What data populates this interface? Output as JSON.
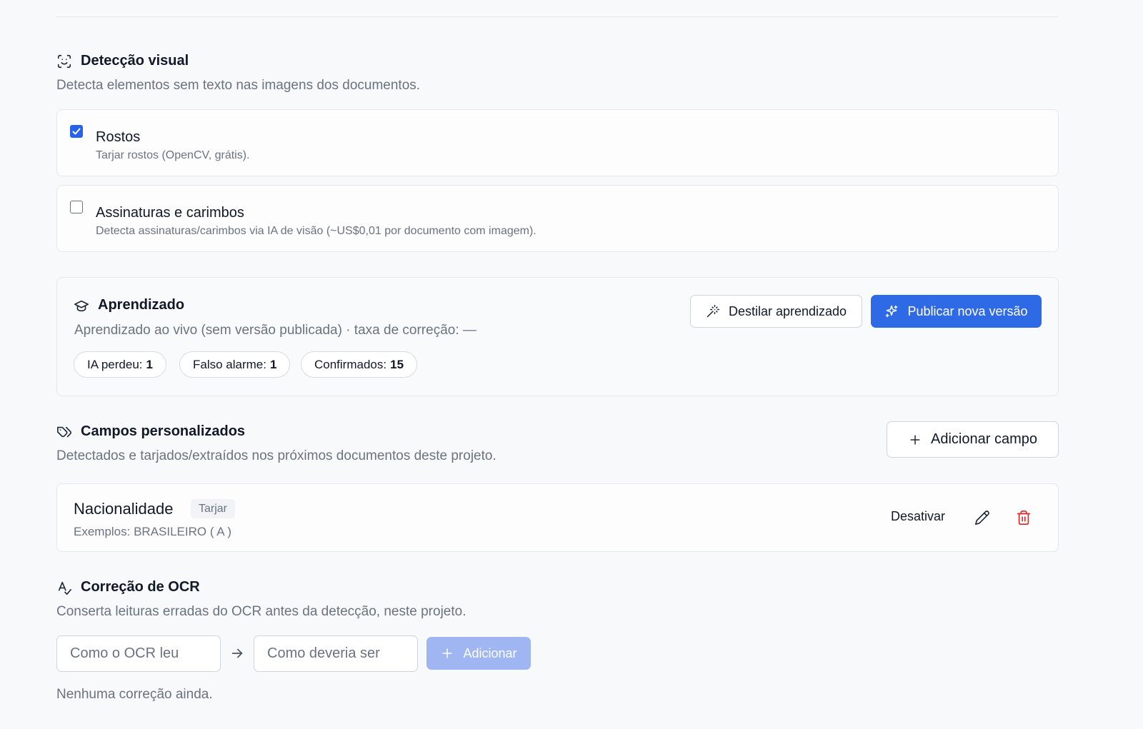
{
  "visual_detection": {
    "title": "Detecção visual",
    "description": "Detecta elementos sem texto nas imagens dos documentos.",
    "options": [
      {
        "title": "Rostos",
        "subtitle": "Tarjar rostos (OpenCV, grátis).",
        "checked": true
      },
      {
        "title": "Assinaturas e carimbos",
        "subtitle": "Detecta assinaturas/carimbos via IA de visão (~US$0,01 por documento com imagem).",
        "checked": false
      }
    ]
  },
  "learning": {
    "title": "Aprendizado",
    "description": "Aprendizado ao vivo (sem versão publicada) · taxa de correção: —",
    "distill_label": "Destilar aprendizado",
    "publish_label": "Publicar nova versão",
    "stats": [
      {
        "label": "IA perdeu:",
        "value": "1"
      },
      {
        "label": "Falso alarme:",
        "value": "1"
      },
      {
        "label": "Confirmados:",
        "value": "15"
      }
    ]
  },
  "custom_fields": {
    "title": "Campos personalizados",
    "description": "Detectados e tarjados/extraídos nos próximos documentos deste projeto.",
    "add_label": "Adicionar campo",
    "items": [
      {
        "name": "Nacionalidade",
        "badge": "Tarjar",
        "examples": "Exemplos: BRASILEIRO ( A )",
        "deactivate_label": "Desativar"
      }
    ]
  },
  "ocr_correction": {
    "title": "Correção de OCR",
    "description": "Conserta leituras erradas do OCR antes da detecção, neste projeto.",
    "from_placeholder": "Como o OCR leu",
    "to_placeholder": "Como deveria ser",
    "add_label": "Adicionar",
    "empty_text": "Nenhuma correção ainda."
  },
  "colors": {
    "primary": "#2f6ae6",
    "primary_disabled": "#9fb6f2",
    "danger": "#dc2626",
    "text_muted": "#6b7280",
    "border": "#e5e7eb"
  },
  "icons": {
    "visual_detection": "scan-face-icon",
    "learning": "graduation-cap-icon",
    "distill": "magic-wand-icon",
    "publish": "sparkles-icon",
    "custom_fields": "tags-icon",
    "add": "plus-icon",
    "edit": "pencil-icon",
    "delete": "trash-icon",
    "ocr": "spell-check-icon",
    "arrow": "arrow-right-icon"
  }
}
